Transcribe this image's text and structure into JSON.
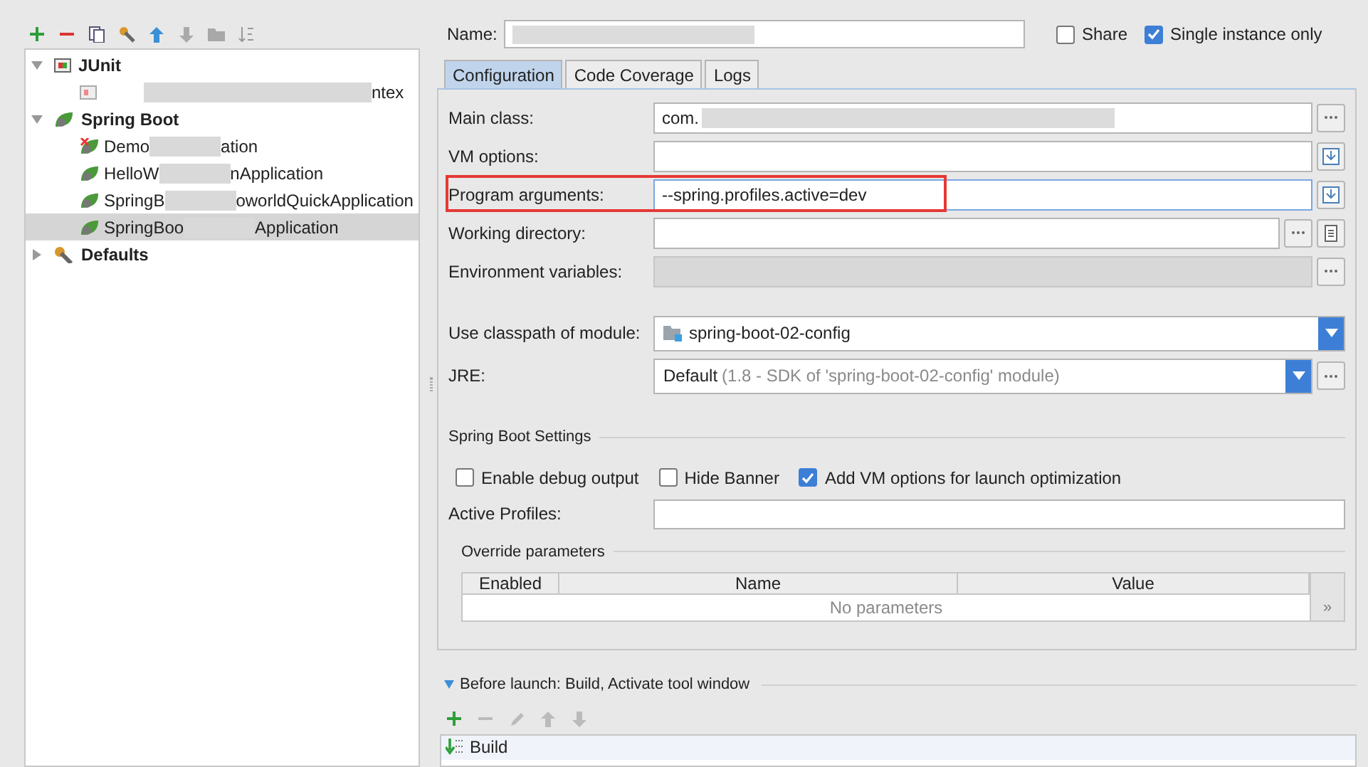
{
  "tree": [
    {
      "label": "JUnit",
      "kind": "junit",
      "expanded": true,
      "selected": false,
      "children": [
        {
          "label_end": "ntex",
          "kind": "junit-item",
          "selected": false
        }
      ]
    },
    {
      "label": "Spring Boot",
      "kind": "spring",
      "expanded": true,
      "selected": false,
      "children": [
        {
          "label": "Demo",
          "label_end": "ation",
          "kind": "spring-error",
          "selected": false
        },
        {
          "label": "HelloW",
          "label_end": "nApplication",
          "kind": "spring-item",
          "selected": false
        },
        {
          "label": "SpringB",
          "label_end": "oworldQuickApplication",
          "kind": "spring-item",
          "selected": false
        },
        {
          "label": "SpringBoo",
          "label_end": "Application",
          "kind": "spring-item",
          "selected": true
        }
      ]
    },
    {
      "label": "Defaults",
      "kind": "defaults",
      "expanded": false,
      "selected": false
    }
  ],
  "name_label": "Name:",
  "share": {
    "label": "Share",
    "checked": false
  },
  "single_instance": {
    "label": "Single instance only",
    "checked": true
  },
  "tabs": [
    {
      "label": "Configuration",
      "selected": true
    },
    {
      "label": "Code Coverage",
      "selected": false
    },
    {
      "label": "Logs",
      "selected": false
    }
  ],
  "fields": [
    {
      "label": "Main class:",
      "value": "com.",
      "kind": "text",
      "browse_button": true,
      "disabled": false,
      "highlighted": false
    },
    {
      "label": "VM options:",
      "kind": "text",
      "expand_button": true,
      "disabled": false,
      "highlighted": false
    },
    {
      "label": "Program arguments:",
      "value": "--spring.profiles.active=dev",
      "kind": "text",
      "expand_button": true,
      "disabled": false,
      "highlighted": true
    },
    {
      "label": "Working directory:",
      "kind": "text",
      "browse_button": true,
      "file_button": true,
      "disabled": false,
      "highlighted": false
    },
    {
      "label": "Environment variables:",
      "kind": "text",
      "browse_button": true,
      "disabled": true,
      "highlighted": false
    },
    {
      "label": "Use classpath of module:",
      "value": "spring-boot-02-config",
      "kind": "module"
    },
    {
      "label": "JRE:",
      "value": "Default",
      "hint": "(1.8 - SDK of 'spring-boot-02-config' module)",
      "kind": "jre",
      "browse_button": true
    }
  ],
  "spring_settings": {
    "title": "Spring Boot Settings",
    "options": [
      {
        "label": "Enable debug output",
        "checked": false
      },
      {
        "label": "Hide Banner",
        "checked": false
      },
      {
        "label": "Add VM options for launch optimization",
        "checked": true
      }
    ],
    "active_profiles_label": "Active Profiles:",
    "override": {
      "title": "Override parameters",
      "columns": [
        "Enabled",
        "Name",
        "Value"
      ],
      "empty_text": "No parameters",
      "more": "»"
    }
  },
  "before_launch": {
    "title": "Before launch: Build, Activate tool window",
    "expanded": true,
    "tasks": [
      {
        "label": "Build"
      }
    ]
  }
}
